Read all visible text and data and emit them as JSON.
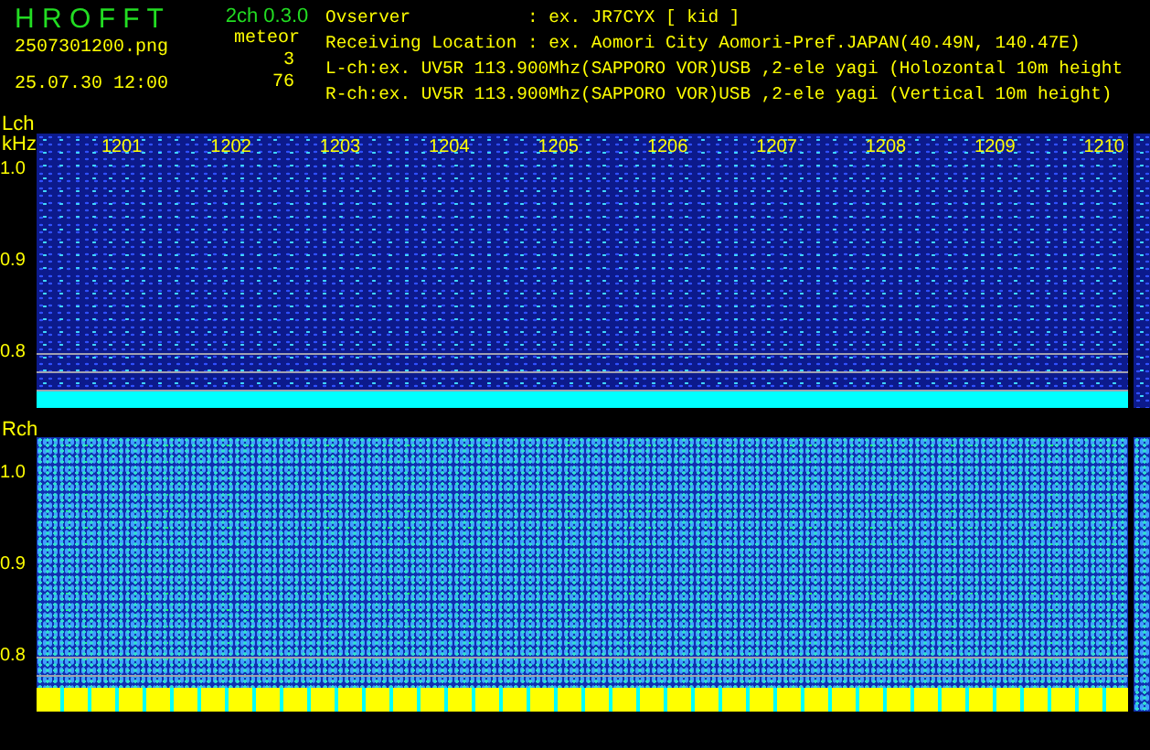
{
  "app": {
    "title": "H R O F F T",
    "version": "2ch 0.3.0",
    "filename": "2507301200.png",
    "timestamp": "25.07.30 12:00"
  },
  "meteor": {
    "label": "meteor",
    "counts": [
      "3",
      "76"
    ]
  },
  "info_lines": [
    "Ovserver           : ex. JR7CYX [ kid ]",
    "Receiving Location : ex. Aomori City Aomori-Pref.JAPAN(40.49N, 140.47E)",
    "L-ch:ex. UV5R 113.900Mhz(SAPPORO VOR)USB ,2-ele yagi (Holozontal 10m height",
    "R-ch:ex. UV5R 113.900Mhz(SAPPORO VOR)USB ,2-ele yagi (Vertical 10m height)"
  ],
  "panels": [
    {
      "channel": "Lch",
      "unit": "kHz",
      "frequencies": [
        "1201",
        "1202",
        "1203",
        "1204",
        "1205",
        "1206",
        "1207",
        "1208",
        "1209",
        "1210"
      ],
      "yticks": [
        "1.0",
        "0.9",
        "0.8"
      ],
      "kind": "sparse"
    },
    {
      "channel": "Rch",
      "yticks": [
        "1.0",
        "0.9",
        "0.8"
      ],
      "kind": "dense"
    }
  ]
}
